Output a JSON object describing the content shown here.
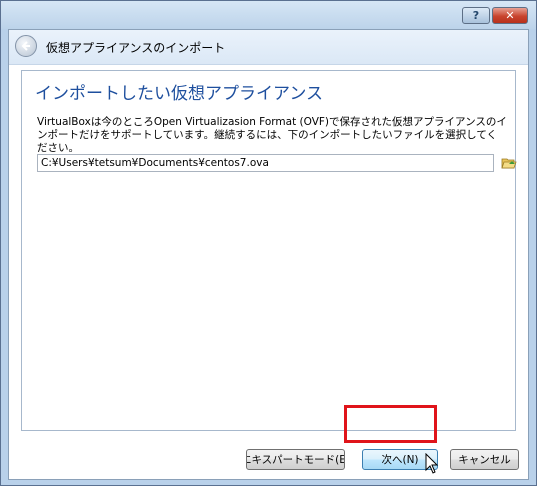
{
  "window": {
    "help_glyph": "?",
    "close_glyph": "✕"
  },
  "dialog": {
    "title": "仮想アプライアンスのインポート",
    "heading": "インポートしたい仮想アプライアンス",
    "description": "VirtualBoxは今のところOpen Virtualizasion Format (OVF)で保存された仮想アプライアンスのインポートだけをサポートしています。継続するには、下のインポートしたいファイルを選択してください。",
    "file_path": "C:¥Users¥tetsum¥Documents¥centos7.ova"
  },
  "buttons": {
    "expert": "エキスパートモード(E)",
    "next": "次へ(N)",
    "cancel": "キャンセル"
  },
  "colors": {
    "heading": "#1e4f9e",
    "highlight": "#e0141a"
  },
  "icons": [
    "back-arrow-icon",
    "help-icon",
    "close-icon",
    "folder-open-icon",
    "mouse-cursor-icon"
  ]
}
